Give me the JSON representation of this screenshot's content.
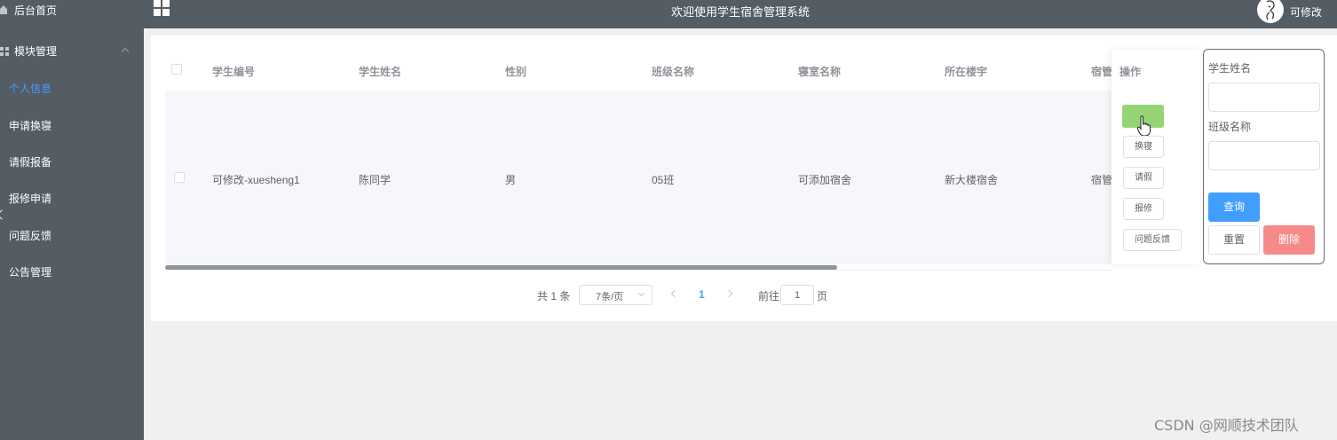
{
  "sidebar": {
    "home_label": "后台首页",
    "module_label": "模块管理",
    "items": [
      {
        "label": "个人信息"
      },
      {
        "label": "申请换寝"
      },
      {
        "label": "请假报备"
      },
      {
        "label": "报修申请"
      },
      {
        "label": "问题反馈"
      },
      {
        "label": "公告管理"
      }
    ],
    "active_color": "#409eff",
    "bg_color": "#545c64"
  },
  "header": {
    "title": "欢迎使用学生宿舍管理系统",
    "username": "可修改"
  },
  "table": {
    "columns": [
      "学生编号",
      "学生姓名",
      "性别",
      "班级名称",
      "寝室名称",
      "所在楼宇",
      "宿管"
    ],
    "ops_header": "操作",
    "rows": [
      {
        "cells": [
          "可修改-xuesheng1",
          "陈同学",
          "男",
          "05班",
          "可添加宿舍",
          "新大楼宿舍",
          "宿管"
        ]
      }
    ],
    "row_actions": [
      "换寝",
      "请假",
      "报修",
      "问题反馈"
    ]
  },
  "search": {
    "name_label": "学生姓名",
    "class_label": "班级名称",
    "query_label": "查询",
    "reset_label": "重置",
    "delete_label": "删除"
  },
  "pagination": {
    "total": "共 1 条",
    "page_size": "7条/页",
    "current": "1",
    "goto_label": "前往",
    "goto_value": "1",
    "page_unit": "页"
  },
  "watermark": "CSDN @网顺技术团队"
}
